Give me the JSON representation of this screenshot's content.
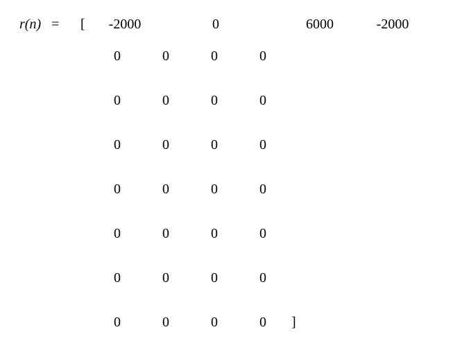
{
  "label": "r(n)",
  "eq": "=",
  "open": "[",
  "close": "]",
  "row1": {
    "a": "-2000",
    "b": "0",
    "c": "6000",
    "d": "-2000"
  },
  "rows": [
    {
      "a": "0",
      "b": "0",
      "c": "0",
      "d": "0"
    },
    {
      "a": "0",
      "b": "0",
      "c": "0",
      "d": "0"
    },
    {
      "a": "0",
      "b": "0",
      "c": "0",
      "d": "0"
    },
    {
      "a": "0",
      "b": "0",
      "c": "0",
      "d": "0"
    },
    {
      "a": "0",
      "b": "0",
      "c": "0",
      "d": "0"
    },
    {
      "a": "0",
      "b": "0",
      "c": "0",
      "d": "0"
    },
    {
      "a": "0",
      "b": "0",
      "c": "0",
      "d": "0"
    }
  ],
  "chart_data": {
    "type": "table",
    "title": "r(n) matrix definition",
    "rows": [
      [
        -2000,
        null,
        0,
        null,
        6000,
        -2000
      ],
      [
        0,
        0,
        0,
        0
      ],
      [
        0,
        0,
        0,
        0
      ],
      [
        0,
        0,
        0,
        0
      ],
      [
        0,
        0,
        0,
        0
      ],
      [
        0,
        0,
        0,
        0
      ],
      [
        0,
        0,
        0,
        0
      ],
      [
        0,
        0,
        0,
        0
      ]
    ]
  }
}
